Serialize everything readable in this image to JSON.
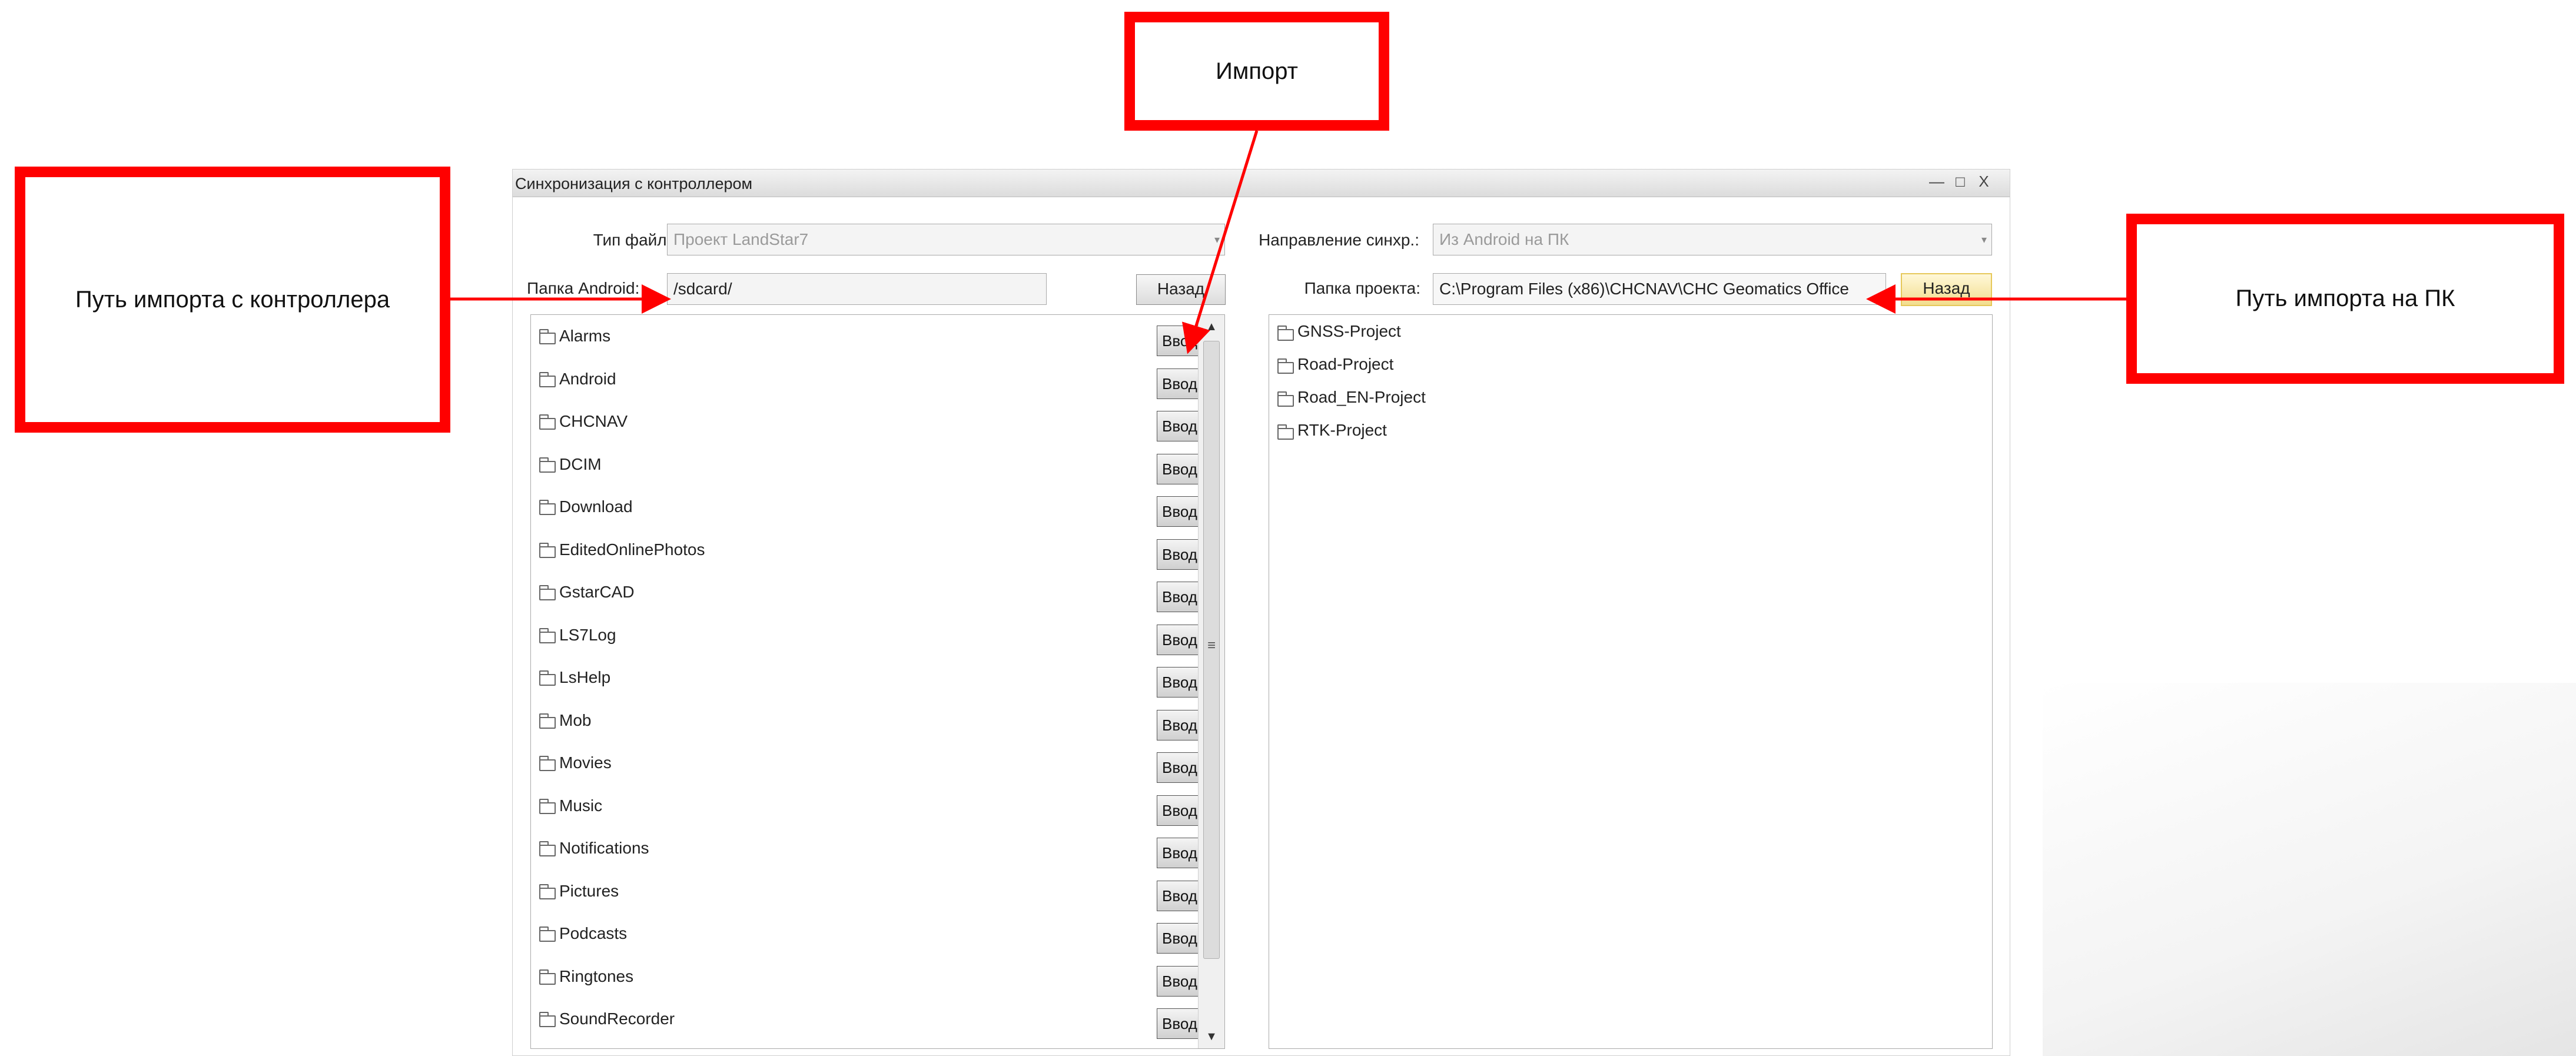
{
  "callouts": {
    "import": "Импорт",
    "android_path": "Путь импорта с контроллера",
    "pc_path": "Путь импорта на ПК"
  },
  "window": {
    "title": "Синхронизация с контроллером",
    "controls": {
      "minimize": "—",
      "maximize": "□",
      "close": "X"
    }
  },
  "form": {
    "file_type_label": "Тип файла:",
    "file_type_value": "Проект LandStar7",
    "sync_direction_label": "Направление синхр.:",
    "sync_direction_value": "Из Android на ПК",
    "android_folder_label": "Папка Android:",
    "android_folder_value": "/sdcard/",
    "android_back_label": "Назад",
    "project_folder_label": "Папка проекта:",
    "project_folder_value": "C:\\Program Files (x86)\\CHCNAV\\CHC Geomatics Office",
    "project_back_label": "Назад"
  },
  "android_list": {
    "enter_label": "Ввод",
    "items": [
      "Alarms",
      "Android",
      "CHCNAV",
      "DCIM",
      "Download",
      "EditedOnlinePhotos",
      "GstarCAD",
      "LS7Log",
      "LsHelp",
      "Mob",
      "Movies",
      "Music",
      "Notifications",
      "Pictures",
      "Podcasts",
      "Ringtones",
      "SoundRecorder"
    ]
  },
  "pc_list": {
    "items": [
      "GNSS-Project",
      "Road-Project",
      "Road_EN-Project",
      "RTK-Project"
    ]
  },
  "scrollbar": {
    "up": "▲",
    "down": "▼",
    "grip": "≡"
  },
  "colors": {
    "callout_border": "#ff0000",
    "arrow": "#ff0000"
  }
}
